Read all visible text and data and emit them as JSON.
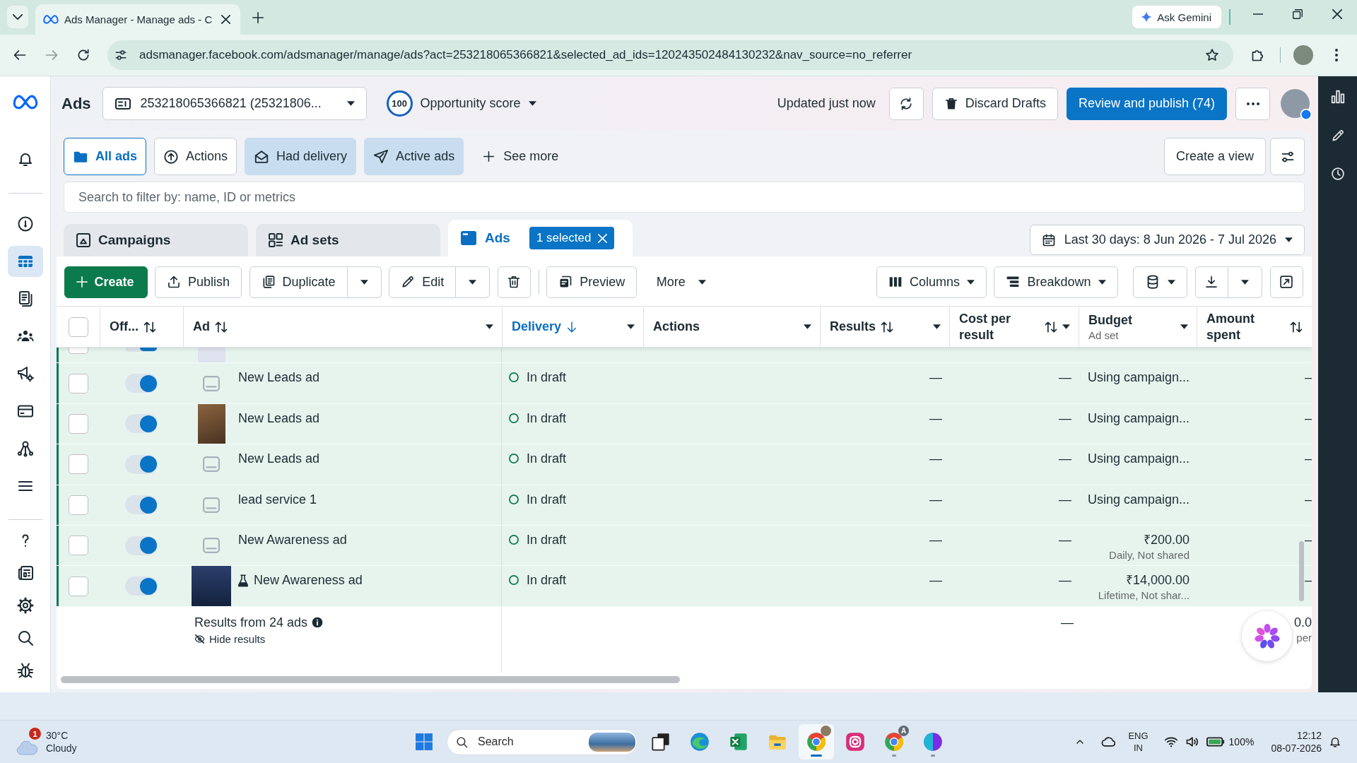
{
  "browser": {
    "tab_title": "Ads Manager - Manage ads - C",
    "gemini": "Ask Gemini",
    "url": "adsmanager.facebook.com/adsmanager/manage/ads?act=253218065366821&selected_ad_ids=120243502484130232&nav_source=no_referrer"
  },
  "nav": [
    {
      "items": [
        {
          "kind": "bell",
          "selected": false
        }
      ]
    },
    {
      "items": [
        {
          "kind": "gauge",
          "selected": false
        },
        {
          "kind": "table",
          "selected": true
        },
        {
          "kind": "pages",
          "selected": false
        },
        {
          "kind": "people",
          "selected": false
        },
        {
          "kind": "megaphone",
          "selected": false
        },
        {
          "kind": "card",
          "selected": false
        },
        {
          "kind": "network",
          "selected": false
        },
        {
          "kind": "menu",
          "selected": false
        }
      ]
    },
    {
      "items": [
        {
          "kind": "help",
          "selected": false
        },
        {
          "kind": "news",
          "selected": false
        },
        {
          "kind": "settings",
          "selected": false
        },
        {
          "kind": "search",
          "selected": false
        },
        {
          "kind": "bug",
          "selected": false
        }
      ]
    }
  ],
  "header": {
    "title": "Ads",
    "account": "253218065366821 (25321806...",
    "score": "100",
    "score_label": "Opportunity score",
    "updated": "Updated just now",
    "discard": "Discard Drafts",
    "publish": "Review and publish (74)"
  },
  "filters": [
    {
      "label": "All ads",
      "kind": "folder",
      "selected": true,
      "applied": false
    },
    {
      "label": "Actions",
      "kind": "actions",
      "selected": false,
      "applied": false
    },
    {
      "label": "Had delivery",
      "kind": "delivery",
      "selected": false,
      "applied": true
    },
    {
      "label": "Active ads",
      "kind": "send",
      "selected": false,
      "applied": true
    }
  ],
  "see_more": "See more",
  "create_view": "Create a view",
  "search": {
    "placeholder": "Search to filter by: name, ID or metrics"
  },
  "levels": [
    {
      "label": "Campaigns",
      "kind": "campaign",
      "selected": false
    },
    {
      "label": "Ad sets",
      "kind": "adset",
      "selected": false
    },
    {
      "label": "Ads",
      "kind": "ad",
      "selected": true,
      "badge": "1 selected"
    }
  ],
  "date_range": "Last 30 days: 8 Jun 2026 - 7 Jul 2026",
  "toolbar": {
    "create": "Create",
    "publish": "Publish",
    "duplicate": "Duplicate",
    "edit": "Edit",
    "preview": "Preview",
    "more": "More",
    "columns": "Columns",
    "breakdown": "Breakdown"
  },
  "table": {
    "all_checked": false,
    "columns": [
      {
        "label": "Off...",
        "sortable": true,
        "sorted": false,
        "menu": false
      },
      {
        "label": "Ad",
        "sortable": true,
        "sorted": false,
        "menu": true
      },
      {
        "label": "Delivery",
        "sortable": true,
        "sorted": true,
        "menu": true
      },
      {
        "label": "Actions",
        "sortable": false,
        "sorted": false,
        "menu": true
      },
      {
        "label": "Results",
        "sortable": true,
        "sorted": false,
        "menu": true
      },
      {
        "label": "Cost per result",
        "sortable": true,
        "sorted": false,
        "menu": true
      },
      {
        "label": "Budget",
        "sub": "Ad set",
        "sortable": false,
        "sorted": false,
        "menu": true
      },
      {
        "label": "Amount spent",
        "sortable": true,
        "sorted": false,
        "menu": false
      }
    ],
    "rows": [
      {
        "kind": "cut",
        "checked": false,
        "on": true,
        "thumbnail": {
          "kind": "strip"
        }
      },
      {
        "kind": "ad",
        "checked": false,
        "on": true,
        "thumbnail": {
          "kind": "placeholder"
        },
        "test": false,
        "name": "New Leads ad",
        "delivery": "In draft",
        "results": "—",
        "cost": "—",
        "budget": "Using campaign...",
        "amount": "–"
      },
      {
        "kind": "ad",
        "checked": false,
        "on": true,
        "thumbnail": {
          "kind": "portrait"
        },
        "test": false,
        "name": "New Leads ad",
        "delivery": "In draft",
        "results": "—",
        "cost": "—",
        "budget": "Using campaign...",
        "amount": "–"
      },
      {
        "kind": "ad",
        "checked": false,
        "on": true,
        "thumbnail": {
          "kind": "placeholder"
        },
        "test": false,
        "name": "New Leads ad",
        "delivery": "In draft",
        "results": "—",
        "cost": "—",
        "budget": "Using campaign...",
        "amount": "–"
      },
      {
        "kind": "ad",
        "checked": false,
        "on": true,
        "thumbnail": {
          "kind": "placeholder"
        },
        "test": false,
        "name": "lead service 1",
        "delivery": "In draft",
        "results": "—",
        "cost": "—",
        "budget": "Using campaign...",
        "amount": "–"
      },
      {
        "kind": "ad",
        "checked": false,
        "on": true,
        "thumbnail": {
          "kind": "placeholder"
        },
        "test": false,
        "name": "New Awareness ad",
        "delivery": "In draft",
        "results": "—",
        "cost": "—",
        "budget": "₹200.00",
        "budget_note": "Daily, Not shared",
        "amount": "–"
      },
      {
        "kind": "ad",
        "checked": false,
        "on": true,
        "thumbnail": {
          "kind": "square"
        },
        "test": true,
        "name": "New Awareness ad",
        "delivery": "In draft",
        "results": "—",
        "cost": "—",
        "budget": "₹14,000.00",
        "budget_note": "Lifetime, Not shar...",
        "amount": "–"
      }
    ],
    "footer": {
      "summary": "Results from 24 ads",
      "hide": "Hide results",
      "cost": "—",
      "amount": "0.0",
      "amount_note": "per"
    }
  },
  "taskbar": {
    "weather": {
      "badge": "1",
      "temp": "30°C",
      "condition": "Cloudy"
    },
    "search": {
      "label": "Search"
    },
    "apps": [
      {
        "kind": "taskview",
        "active": false,
        "running": false
      },
      {
        "kind": "edge",
        "active": false,
        "running": false
      },
      {
        "kind": "excel",
        "active": false,
        "running": false
      },
      {
        "kind": "files",
        "active": false,
        "running": false
      },
      {
        "kind": "chrome",
        "active": true,
        "running": true,
        "avatar": true
      },
      {
        "kind": "instagram",
        "active": false,
        "running": false
      },
      {
        "kind": "chrome",
        "active": false,
        "running": true,
        "badge": "A"
      },
      {
        "kind": "canva",
        "active": false,
        "running": true
      }
    ],
    "lang": "ENG",
    "region": "IN",
    "battery": "100%",
    "time": "12:12",
    "date": "08-07-2026"
  }
}
